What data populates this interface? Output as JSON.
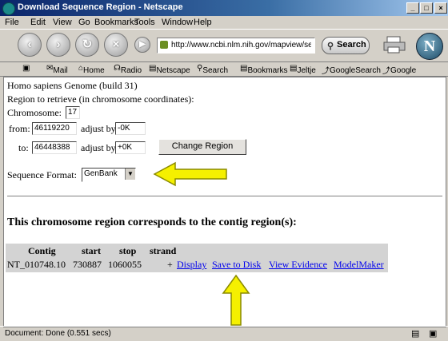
{
  "window": {
    "title": "Download Sequence Region - Netscape",
    "controls": {
      "minimize": "_",
      "maximize": "□",
      "close": "×"
    }
  },
  "menu": [
    "File",
    "Edit",
    "View",
    "Go",
    "Bookmarks",
    "Tools",
    "Window",
    "Help"
  ],
  "toolbar": {
    "url": "http://www.ncbi.nlm.nih.gov/mapview/sec",
    "search_label": "Search"
  },
  "personal_bar": {
    "items": [
      "Mail",
      "Home",
      "Radio",
      "Netscape",
      "Search",
      "Bookmarks",
      "Jeltje",
      "GoogleSearch",
      "Google"
    ],
    "icons": [
      "mail-icon",
      "home-icon",
      "radio-icon",
      "netscape-icon",
      "search-icon",
      "bookmarks-icon",
      "folder-icon",
      "link-icon",
      "link-icon"
    ]
  },
  "page": {
    "genome": "Homo sapiens Genome (build 31)",
    "region_heading": "Region to retrieve (in chromosome coordinates):",
    "chromosome_label": "Chromosome:",
    "chromosome_value": "17",
    "from_label": "from:",
    "from_value": "46119220",
    "from_adjust_label": "adjust by:",
    "from_adjust_value": "-0K",
    "to_label": "to:",
    "to_value": "46448388",
    "to_adjust_label": "adjust by:",
    "to_adjust_value": "+0K",
    "change_region_button": "Change Region",
    "format_label": "Sequence Format:",
    "format_value": "GenBank",
    "contig_heading": "This chromosome region corresponds to the contig region(s):",
    "table": {
      "headers": [
        "Contig",
        "start",
        "stop",
        "strand"
      ],
      "row": {
        "contig": "NT_010748.10",
        "start": "730887",
        "stop": "1060055",
        "strand": "+"
      },
      "links": [
        "Display",
        "Save to Disk",
        "View Evidence",
        "ModelMaker"
      ]
    }
  },
  "status": {
    "text": "Document: Done (0.551 secs)"
  },
  "colors": {
    "link": "#0000ee",
    "arrow": "#f5f000",
    "titlebar": "#0a246a"
  }
}
